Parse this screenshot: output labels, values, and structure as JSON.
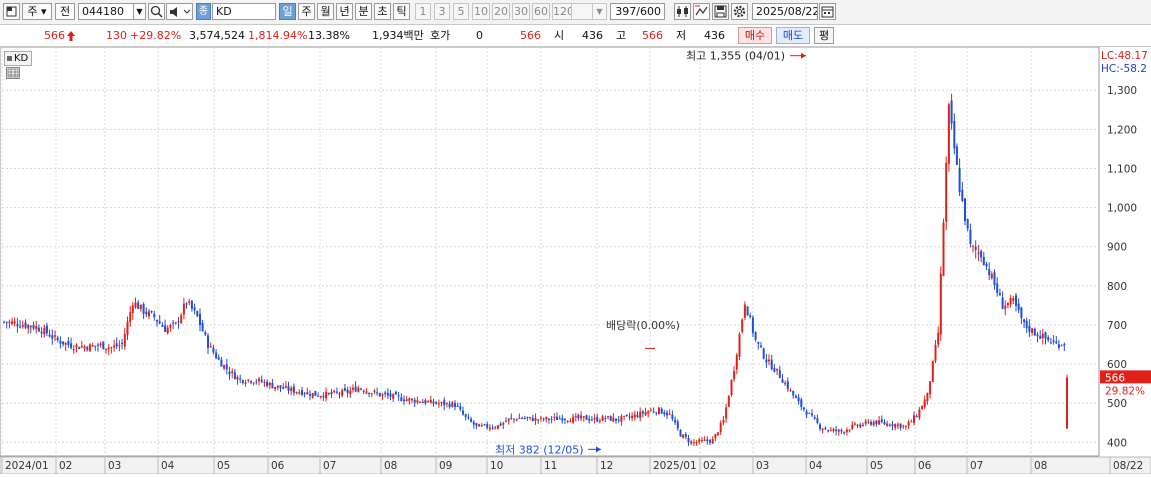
{
  "toolbar": {
    "period_label": "주",
    "prev_label": "전",
    "stock_code": "044180",
    "market_badge": "종",
    "stock_name": "KD",
    "period_tabs": [
      "일",
      "주",
      "월",
      "년",
      "분",
      "초",
      "틱"
    ],
    "active_period": "일",
    "interval_buttons": [
      "1",
      "3",
      "5",
      "10",
      "20",
      "30",
      "60",
      "120"
    ],
    "count": "397/600",
    "date": "2025/08/22"
  },
  "quote": {
    "price": "566",
    "change": "130",
    "change_pct": "+29.82%",
    "volume": "3,574,524",
    "volume_pct": "1,814.94%",
    "turnover": "13.38%",
    "amount": "1,934백만",
    "hoga_label": "호가",
    "hoga_value": "0",
    "hoga_price": "566",
    "open_label": "시",
    "open": "436",
    "high_label": "고",
    "high": "566",
    "low_label": "저",
    "low": "436",
    "buy_label": "매수",
    "sell_label": "매도",
    "eval_label": "평"
  },
  "chart_legend": "KD",
  "chart_data": {
    "type": "candlestick",
    "ylim": [
      365,
      1390
    ],
    "y_ticks": [
      400,
      500,
      600,
      700,
      800,
      900,
      1000,
      1100,
      1200,
      1300
    ],
    "y_tick_labels": [
      "400",
      "500",
      "600",
      "700",
      "800",
      "900",
      "1,000",
      "1,100",
      "1,200",
      "1,300"
    ],
    "x_labels": [
      "2024/01",
      "02",
      "03",
      "04",
      "05",
      "06",
      "07",
      "08",
      "09",
      "10",
      "11",
      "12",
      "2025/01",
      "02",
      "03",
      "04",
      "05",
      "06",
      "07",
      "08",
      "08/22"
    ],
    "series": {
      "x": [
        0,
        4,
        8,
        12,
        16,
        20,
        24,
        28,
        32,
        36,
        40,
        44,
        48,
        52,
        56,
        60,
        64,
        68,
        72,
        76,
        80,
        84,
        88,
        92,
        96,
        100,
        104,
        108,
        112,
        116,
        120,
        124,
        128,
        132,
        136,
        140,
        144,
        148,
        152,
        156,
        160,
        164,
        168,
        172,
        176,
        180,
        184,
        188,
        192,
        196,
        200,
        204,
        208,
        212,
        216,
        220,
        224,
        228,
        232,
        236,
        240,
        244,
        248,
        252,
        256,
        260,
        264,
        268,
        272,
        276,
        280,
        284,
        288,
        292,
        296,
        300,
        304,
        308,
        312,
        316,
        320,
        324,
        328,
        332,
        336,
        340,
        344,
        348,
        352,
        356,
        360,
        364,
        368,
        372,
        376,
        380,
        384,
        388,
        392,
        396
      ],
      "close": [
        708,
        705,
        700,
        695,
        680,
        660,
        650,
        645,
        645,
        648,
        642,
        650,
        760,
        735,
        720,
        690,
        700,
        760,
        720,
        650,
        610,
        580,
        560,
        560,
        555,
        545,
        538,
        532,
        528,
        522,
        522,
        525,
        528,
        540,
        530,
        522,
        518,
        512,
        508,
        505,
        500,
        498,
        496,
        462,
        440,
        440,
        442,
        458,
        462,
        460,
        458,
        460,
        462,
        460,
        462,
        458,
        462,
        458,
        462,
        470,
        480,
        482,
        470,
        420,
        400,
        402,
        405,
        455,
        590,
        760,
        660,
        610,
        580,
        540,
        500,
        470,
        440,
        430,
        428,
        440,
        446,
        452,
        448,
        446,
        440,
        470,
        520,
        680,
        1250,
        1050,
        900,
        880,
        820,
        750,
        760,
        700,
        680,
        665,
        650,
        655,
        640,
        600,
        615,
        600,
        580,
        555,
        520,
        490,
        470,
        455,
        460,
        566
      ],
      "_note": "close values sampled along the chart"
    },
    "annotations": {
      "high": "최고 1,355 (04/01)",
      "low": "최저 382 (12/05)",
      "ex_rights": "배당락(0.00%)"
    },
    "right_axis": {
      "lc": "LC:48.17",
      "hc": "HC:-58.2",
      "last_price": "566",
      "last_pct": "29.82%"
    }
  },
  "colors": {
    "up": "#e0211a",
    "down": "#1f4fd8",
    "grid": "#d8d8d8",
    "accent": "#6f9fd8"
  }
}
